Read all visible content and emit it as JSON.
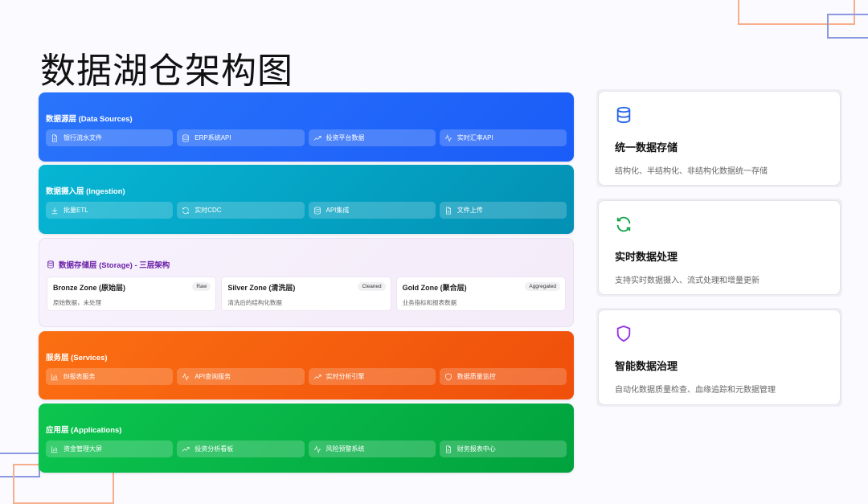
{
  "title": "数据湖仓架构图",
  "layers": [
    {
      "title": "数据源层 (Data Sources)",
      "items": [
        {
          "label": "银行流水文件",
          "icon": "file-icon"
        },
        {
          "label": "ERP系统API",
          "icon": "database-icon"
        },
        {
          "label": "投资平台数据",
          "icon": "trending-up-icon"
        },
        {
          "label": "实时汇率API",
          "icon": "activity-icon"
        }
      ]
    },
    {
      "title": "数据摄入层 (Ingestion)",
      "items": [
        {
          "label": "批量ETL",
          "icon": "download-icon"
        },
        {
          "label": "实时CDC",
          "icon": "refresh-icon"
        },
        {
          "label": "API集成",
          "icon": "database-icon"
        },
        {
          "label": "文件上传",
          "icon": "file-icon"
        }
      ]
    },
    {
      "title": "数据存储层 (Storage) - 三层架构",
      "zones": [
        {
          "name": "Bronze Zone (原始层)",
          "tag": "Raw",
          "desc": "原始数据，未处理"
        },
        {
          "name": "Silver Zone (清洗层)",
          "tag": "Cleaned",
          "desc": "清洗后的结构化数据"
        },
        {
          "name": "Gold Zone (聚合层)",
          "tag": "Aggregated",
          "desc": "业务指标和报表数据"
        }
      ]
    },
    {
      "title": "服务层 (Services)",
      "items": [
        {
          "label": "BI报表服务",
          "icon": "bar-chart-icon"
        },
        {
          "label": "API查询服务",
          "icon": "activity-icon"
        },
        {
          "label": "实时分析引擎",
          "icon": "trending-up-icon"
        },
        {
          "label": "数据质量监控",
          "icon": "shield-icon"
        }
      ]
    },
    {
      "title": "应用层 (Applications)",
      "items": [
        {
          "label": "资金管理大屏",
          "icon": "bar-chart-icon"
        },
        {
          "label": "投资分析看板",
          "icon": "trending-up-icon"
        },
        {
          "label": "风险预警系统",
          "icon": "activity-icon"
        },
        {
          "label": "财务报表中心",
          "icon": "file-icon"
        }
      ]
    }
  ],
  "features": [
    {
      "title": "统一数据存储",
      "desc": "结构化、半结构化、非结构化数据统一存储",
      "icon": "database-icon",
      "color": "#2563eb"
    },
    {
      "title": "实时数据处理",
      "desc": "支持实时数据摄入、流式处理和增量更新",
      "icon": "refresh-icon",
      "color": "#16a34a"
    },
    {
      "title": "智能数据治理",
      "desc": "自动化数据质量检查、血缘追踪和元数据管理",
      "icon": "shield-icon",
      "color": "#9333ea"
    }
  ],
  "colors": {
    "sources": "#2a6cf6",
    "ingestion": "#06b0d4",
    "storage": "#f5eefa",
    "services": "#f96b0e",
    "applications": "#0cc04f"
  }
}
